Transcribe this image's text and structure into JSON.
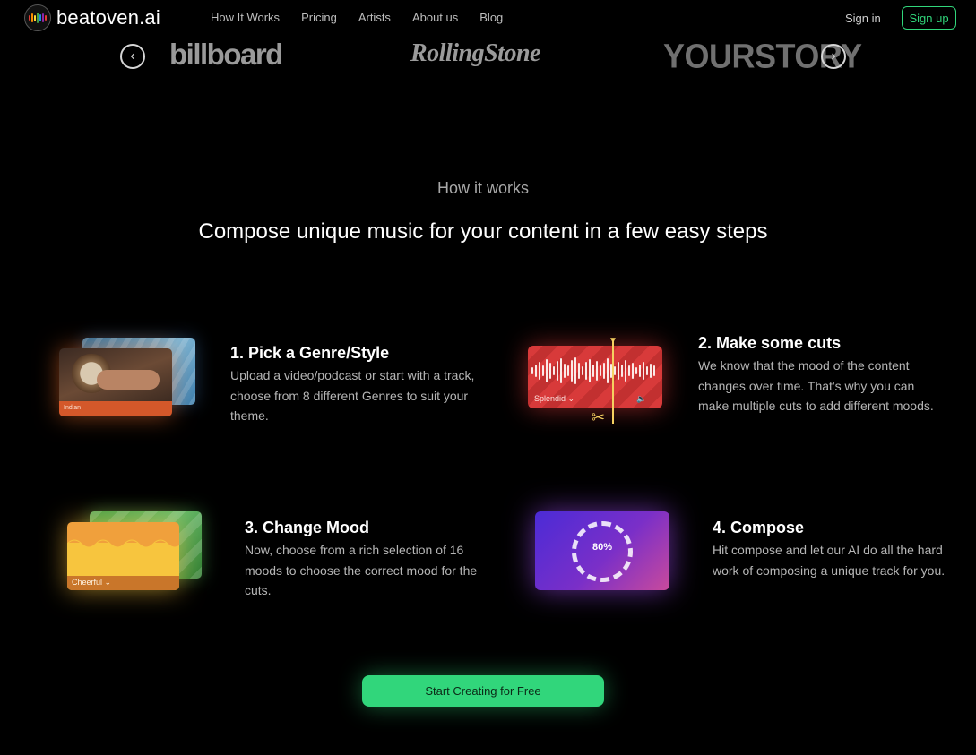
{
  "nav": {
    "logo_text": "beatoven.ai",
    "links": [
      "How It Works",
      "Pricing",
      "Artists",
      "About us",
      "Blog"
    ],
    "signin": "Sign in",
    "signup": "Sign up"
  },
  "press": {
    "logos": [
      "billboard",
      "RollingStone",
      "YOURSTORY"
    ]
  },
  "section": {
    "kicker": "How it works",
    "headline": "Compose unique music for your content in a few easy steps"
  },
  "steps": [
    {
      "title": "1. Pick a Genre/Style",
      "desc": "Upload a video/podcast or start with a track, choose from 8 different Genres to suit your theme.",
      "visual_label": "Indian"
    },
    {
      "title": "2. Make some cuts",
      "desc": "We know that the mood of the content changes over time. That's why you can make multiple cuts to add different moods.",
      "visual_label": "Splendid ⌄"
    },
    {
      "title": "3. Change Mood",
      "desc": "Now, choose from a rich selection of 16 moods to choose the correct mood for the cuts.",
      "visual_label": "Cheerful ⌄"
    },
    {
      "title": "4. Compose",
      "desc": "Hit compose and let our AI do all the hard work of composing a unique track for you.",
      "visual_label": "80%"
    }
  ],
  "cta": {
    "label": "Start Creating for Free"
  },
  "colors": {
    "accent": "#31d67b",
    "background": "#000000"
  }
}
